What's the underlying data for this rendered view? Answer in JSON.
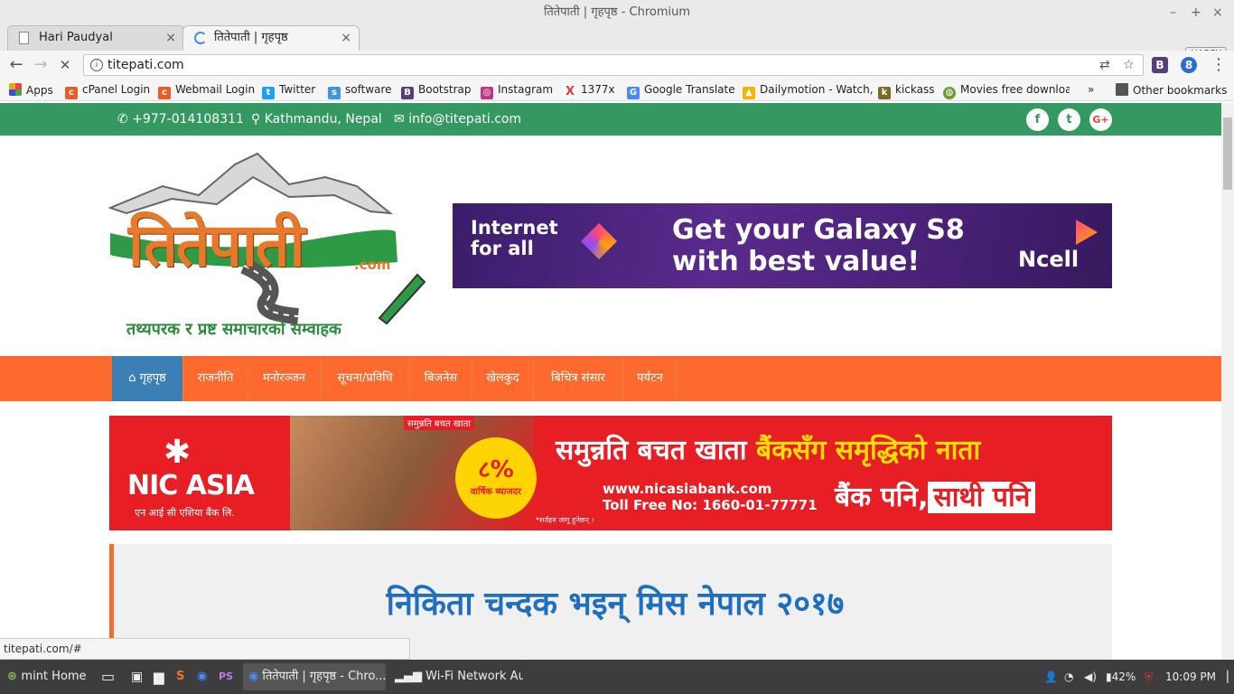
{
  "window": {
    "title": "तितेपाती | गृहपृष्ठ - Chromium",
    "minimize": "–",
    "maximize": "+",
    "close": "×"
  },
  "tabs": [
    {
      "label": "Hari Paudyal",
      "close": "×"
    },
    {
      "label": "तितेपाती | गृहपृष्ठ",
      "close": "×"
    }
  ],
  "profile": "HARRY",
  "toolbar": {
    "back": "←",
    "forward": "→",
    "stop": "✕",
    "url": "titepati.com",
    "info": "i",
    "translate": "⇄",
    "star": "☆",
    "menu": "⋮"
  },
  "bookmarks": [
    {
      "label": "Apps",
      "icon": "apps-grid"
    },
    {
      "label": "cPanel Login",
      "icon": "cpanel"
    },
    {
      "label": "Webmail Login",
      "icon": "cpanel"
    },
    {
      "label": "Twitter",
      "icon": "twitter"
    },
    {
      "label": "software",
      "icon": "software"
    },
    {
      "label": "Bootstrap",
      "icon": "bootstrap"
    },
    {
      "label": "Instagram",
      "icon": "instagram"
    },
    {
      "label": "1377x",
      "icon": "x"
    },
    {
      "label": "Google Translate",
      "icon": "google-translate"
    },
    {
      "label": "Dailymotion - Watch,",
      "icon": "dailymotion"
    },
    {
      "label": "kickass",
      "icon": "kickass"
    },
    {
      "label": "Movies free downloa",
      "icon": "globe"
    }
  ],
  "bookmarks_more": "»",
  "other_bookmarks": "Other bookmarks",
  "site": {
    "phone": "+977-014108311",
    "location": "Kathmandu, Nepal",
    "email": "info@titepati.com",
    "social": [
      "f",
      "t",
      "G+"
    ],
    "logo": {
      "title": "तितेपाती",
      "dotcom": ".com",
      "tagline": "तथ्यपरक र प्रष्ट समाचारको सम्वाहक"
    },
    "ncell_ad": {
      "left": "Internet for all",
      "main": "Get your Galaxy S8 with best value!",
      "brand": "Ncell"
    },
    "menu": [
      "गृहपृष्ठ",
      "राजनीति",
      "मनोरञ्जन",
      "सूचना/प्रविधि",
      "बिजनेस",
      "खेलकुद",
      "बिचित्र संसार",
      "पर्यटन"
    ],
    "nic_ad": {
      "brand": "NIC ASIA",
      "brand_sub": "एन आई सी एशिया बैंक लि.",
      "tag": "समुन्नति बचत खाता",
      "rate": "८%",
      "rate_sub": "वार्षिक ब्याजदर",
      "headline_white": "समुन्नति बचत खाता",
      "headline_yellow": "बैंकसँग समृद्धिको नाता",
      "web": "www.nicasiabank.com",
      "toll": "Toll Free No: 1660-01-77771",
      "slogan_a": "बैंक पनि,",
      "slogan_b": "साथी पनि",
      "fine": "*शर्तहरु लागू हुनेछन् ।"
    },
    "headline": "निकिता चन्दक भइन् मिस नेपाल २०१७"
  },
  "status_url": "titepati.com/#",
  "taskbar": {
    "menu": "mint Home",
    "windows": [
      "तितेपाती | गृहपृष्ठ - Chro...",
      "Wi-Fi Network Authe..."
    ],
    "battery": "42%",
    "clock": "10:09 PM"
  },
  "colors": {
    "green": "#339960",
    "orange": "#fe6a2d",
    "blue": "#3c7fb4",
    "headline": "#1f6fc0",
    "nic_red": "#e81e25"
  }
}
